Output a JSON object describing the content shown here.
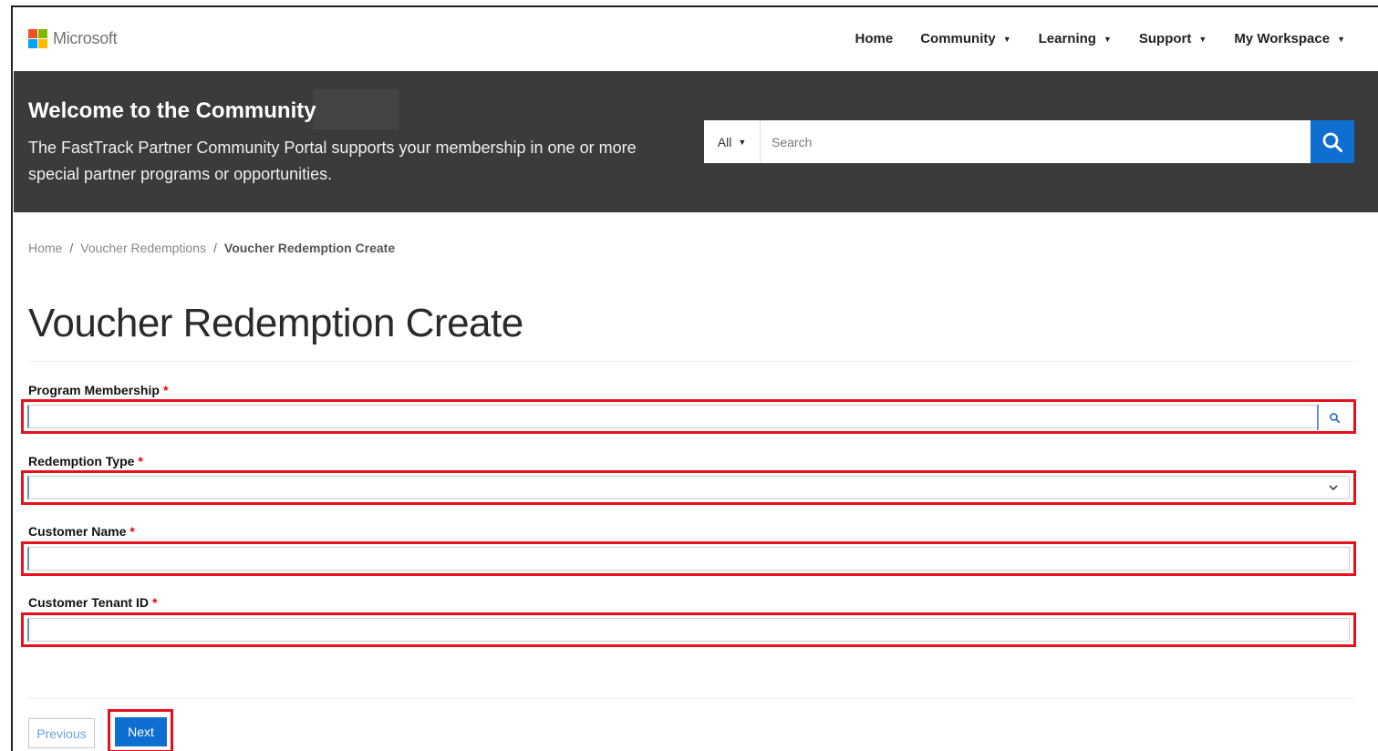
{
  "header": {
    "logo_text": "Microsoft",
    "logo_colors": [
      "#f25022",
      "#7fba00",
      "#00a4ef",
      "#ffb900"
    ],
    "nav": [
      {
        "label": "Home"
      },
      {
        "label": "Community"
      },
      {
        "label": "Learning"
      },
      {
        "label": "Support"
      },
      {
        "label": "My Workspace"
      }
    ]
  },
  "banner": {
    "title": "Welcome to the Community",
    "description": "The FastTrack Partner Community Portal supports your membership in one or more special partner programs or opportunities.",
    "background": "#3b3b3b"
  },
  "search": {
    "filter_label": "All",
    "placeholder": "Search",
    "button_icon": "search-icon",
    "button_color": "#0f6fd1"
  },
  "breadcrumb": {
    "items": [
      "Home",
      "Voucher Redemptions"
    ],
    "current": "Voucher Redemption Create",
    "separator": "/"
  },
  "page": {
    "title": "Voucher Redemption Create"
  },
  "form": {
    "required_marker": "*",
    "fields": [
      {
        "label": "Program Membership",
        "value": "",
        "kind": "lookup"
      },
      {
        "label": "Redemption Type",
        "value": "",
        "kind": "select"
      },
      {
        "label": "Customer Name",
        "value": "",
        "kind": "text"
      },
      {
        "label": "Customer Tenant ID",
        "value": "",
        "kind": "text"
      }
    ]
  },
  "actions": {
    "previous_label": "Previous",
    "next_label": "Next"
  },
  "annotation_color": "#e8101a"
}
